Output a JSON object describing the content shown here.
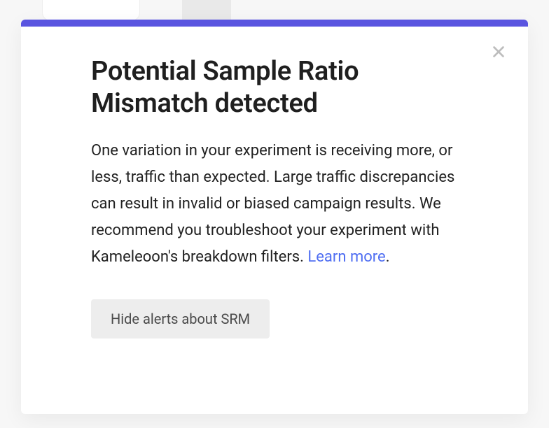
{
  "modal": {
    "title": "Potential Sample Ratio Mismatch detected",
    "description_text": "One variation in your experiment is receiving more, or less, traffic than expected. Large traffic discrepancies can result in invalid or biased campaign results. We recommend you troubleshoot your experiment with Kameleoon's breakdown filters. ",
    "learn_more_label": "Learn more",
    "period": ".",
    "hide_button_label": "Hide alerts about SRM"
  }
}
